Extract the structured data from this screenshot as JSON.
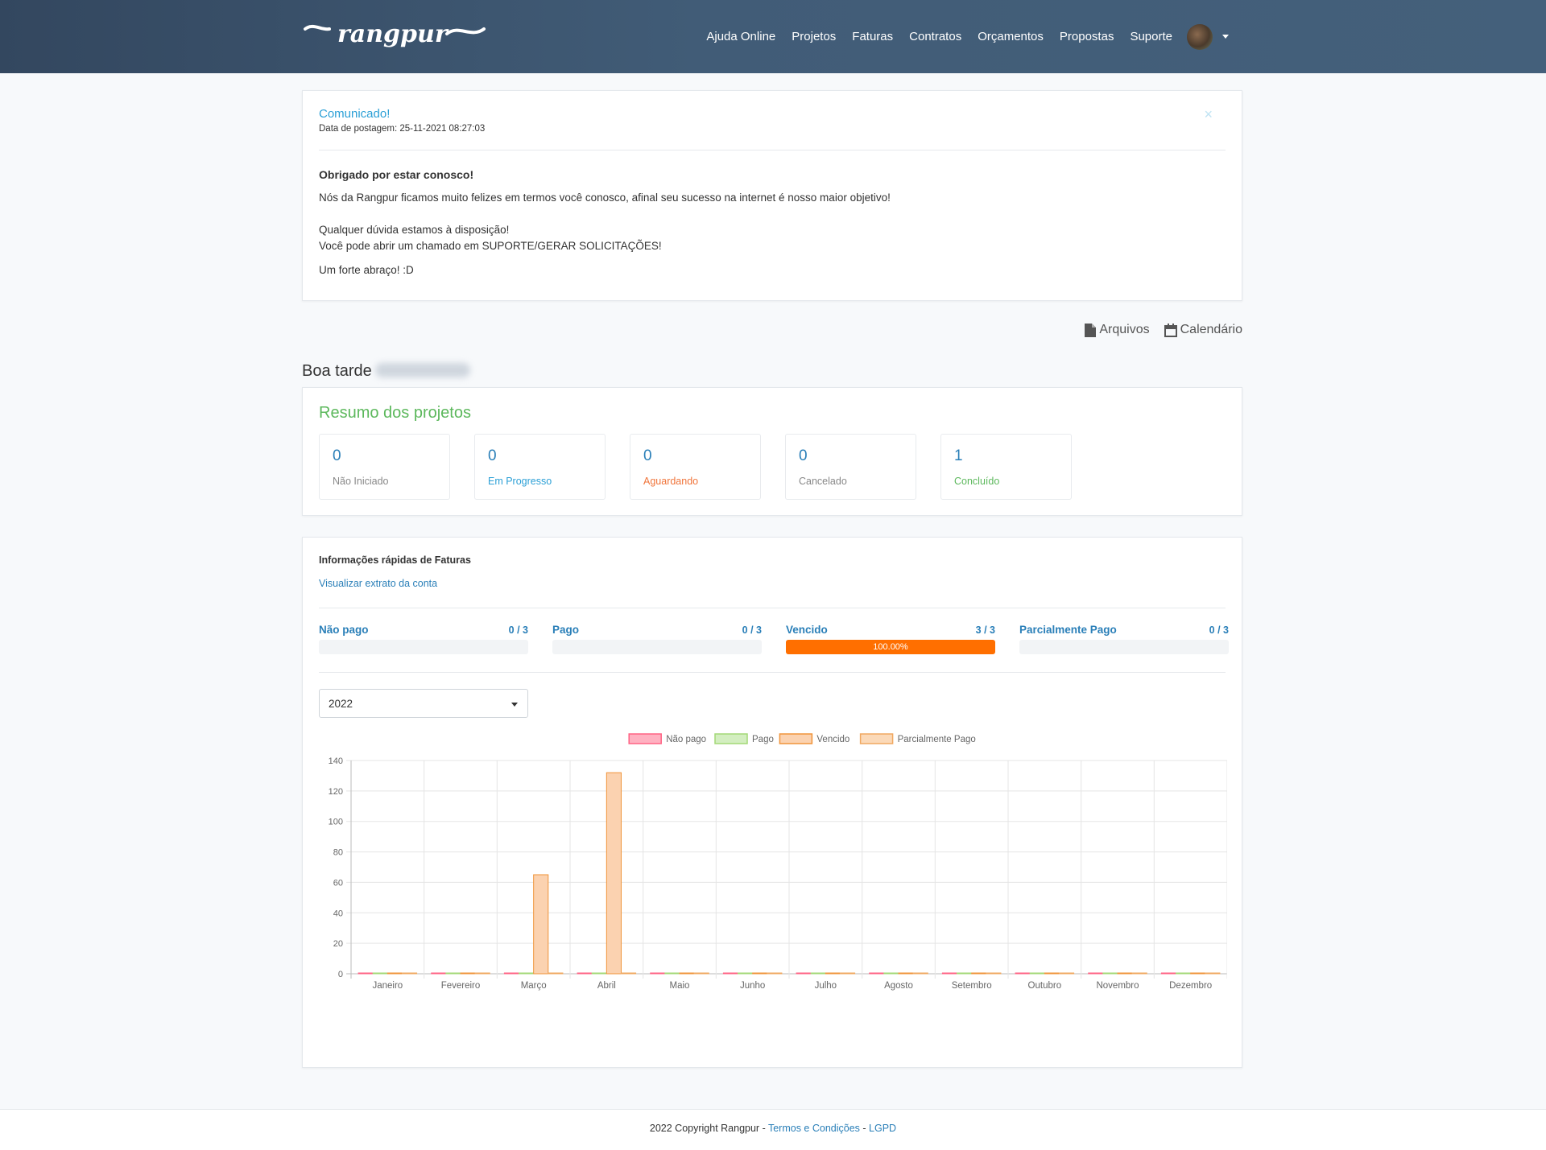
{
  "brand": {
    "logo_text": "rangpur"
  },
  "nav": {
    "items": [
      {
        "label": "Ajuda Online"
      },
      {
        "label": "Projetos"
      },
      {
        "label": "Faturas"
      },
      {
        "label": "Contratos"
      },
      {
        "label": "Orçamentos"
      },
      {
        "label": "Propostas"
      },
      {
        "label": "Suporte"
      }
    ],
    "avatar_icon": "user-avatar"
  },
  "announcement": {
    "title": "Comunicado!",
    "date": "Data de postagem: 25-11-2021 08:27:03",
    "close": "×",
    "heading": "Obrigado por estar conosco!",
    "line1": "Nós da Rangpur ficamos muito felizes em termos você conosco, afinal seu sucesso na internet é nosso maior objetivo!",
    "line2": "Qualquer dúvida estamos à disposição!",
    "line3": "Você pode abrir um chamado em SUPORTE/GERAR SOLICITAÇÕES!",
    "line4": "Um forte abraço! :D"
  },
  "toolbar": {
    "files_label": "Arquivos",
    "calendar_label": "Calendário"
  },
  "greeting": {
    "text": "Boa tarde"
  },
  "summary": {
    "title": "Resumo dos projetos",
    "stats": [
      {
        "value": "0",
        "label": "Não Iniciado",
        "color": "#888888"
      },
      {
        "value": "0",
        "label": "Em Progresso",
        "color": "#2a9fd6"
      },
      {
        "value": "0",
        "label": "Aguardando",
        "color": "#f0743a"
      },
      {
        "value": "0",
        "label": "Cancelado",
        "color": "#888888"
      },
      {
        "value": "1",
        "label": "Concluído",
        "color": "#5cb85c"
      }
    ]
  },
  "invoices": {
    "title": "Informações rápidas de Faturas",
    "statement_link": "Visualizar extrato da conta",
    "stats": [
      {
        "label": "Não pago",
        "count": "0 / 3",
        "fraction": 0,
        "percent_label": ""
      },
      {
        "label": "Pago",
        "count": "0 / 3",
        "fraction": 0,
        "percent_label": ""
      },
      {
        "label": "Vencido",
        "count": "3 / 3",
        "fraction": 1,
        "percent_label": "100.00%"
      },
      {
        "label": "Parcialmente Pago",
        "count": "0 / 3",
        "fraction": 0,
        "percent_label": ""
      }
    ],
    "year_select": "2022"
  },
  "chart_data": {
    "type": "bar",
    "categories": [
      "Janeiro",
      "Fevereiro",
      "Março",
      "Abril",
      "Maio",
      "Junho",
      "Julho",
      "Agosto",
      "Setembro",
      "Outubro",
      "Novembro",
      "Dezembro"
    ],
    "series": [
      {
        "name": "Não pago",
        "color": "#ff6384",
        "fill": "#ffb1c1",
        "values": [
          0,
          0,
          0,
          0,
          0,
          0,
          0,
          0,
          0,
          0,
          0,
          0
        ]
      },
      {
        "name": "Pago",
        "color": "#a3d977",
        "fill": "#d3eec0",
        "values": [
          0,
          0,
          0,
          0,
          0,
          0,
          0,
          0,
          0,
          0,
          0,
          0
        ]
      },
      {
        "name": "Vencido",
        "color": "#f0943a",
        "fill": "#fbd2b0",
        "values": [
          0,
          0,
          65,
          132,
          0,
          0,
          0,
          0,
          0,
          0,
          0,
          0
        ]
      },
      {
        "name": "Parcialmente Pago",
        "color": "#f0a860",
        "fill": "#fbd9b8",
        "values": [
          0,
          0,
          0,
          0,
          0,
          0,
          0,
          0,
          0,
          0,
          0,
          0
        ]
      }
    ],
    "ylim": [
      0,
      140
    ],
    "yticks": [
      0,
      20,
      40,
      60,
      80,
      100,
      120,
      140
    ],
    "grid": true,
    "legend": "top"
  },
  "footer": {
    "copyright": "2022 Copyright Rangpur - ",
    "terms": "Termos e Condições",
    "sep": " - ",
    "lgpd": "LGPD"
  }
}
